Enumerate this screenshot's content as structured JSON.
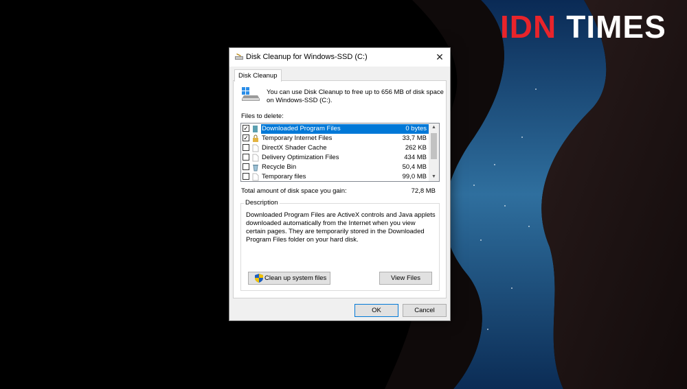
{
  "brand": {
    "part1": "IDN",
    "part2": "TIMES",
    "accent_color": "#e8242b"
  },
  "window": {
    "title": "Disk Cleanup for Windows-SSD (C:)",
    "title_icon": "disk-cleanup-icon",
    "close_glyph": "✕"
  },
  "tabs": [
    {
      "label": "Disk Cleanup",
      "active": true
    }
  ],
  "intro_text": "You can use Disk Cleanup to free up to 656 MB of disk space on Windows-SSD (C:).",
  "files_label": "Files to delete:",
  "files": [
    {
      "name": "Downloaded Program Files",
      "size": "0 bytes",
      "checked": true,
      "selected": true,
      "icon": "folder-icon"
    },
    {
      "name": "Temporary Internet Files",
      "size": "33,7 MB",
      "checked": true,
      "selected": false,
      "icon": "lock-icon"
    },
    {
      "name": "DirectX Shader Cache",
      "size": "262 KB",
      "checked": false,
      "selected": false,
      "icon": "file-icon"
    },
    {
      "name": "Delivery Optimization Files",
      "size": "434 MB",
      "checked": false,
      "selected": false,
      "icon": "file-icon"
    },
    {
      "name": "Recycle Bin",
      "size": "50,4 MB",
      "checked": false,
      "selected": false,
      "icon": "recycle-bin-icon"
    },
    {
      "name": "Temporary files",
      "size": "99,0 MB",
      "checked": false,
      "selected": false,
      "icon": "file-icon"
    }
  ],
  "total": {
    "label": "Total amount of disk space you gain:",
    "value": "72,8 MB"
  },
  "description": {
    "legend": "Description",
    "text": "Downloaded Program Files are ActiveX controls and Java applets downloaded automatically from the Internet when you view certain pages. They are temporarily stored in the Downloaded Program Files folder on your hard disk."
  },
  "buttons": {
    "cleanup_system": "Clean up system files",
    "view_files": "View Files",
    "ok": "OK",
    "cancel": "Cancel"
  },
  "check_glyph": "✓"
}
